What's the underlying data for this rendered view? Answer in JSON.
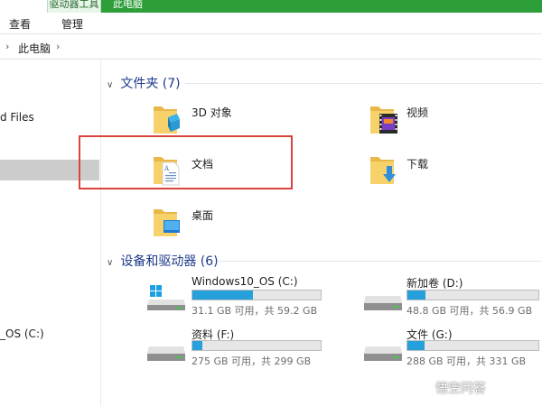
{
  "ribbon": {
    "context_tab": "驱动器工具",
    "window_title": "此电脑",
    "tabs": [
      "查看",
      "管理"
    ]
  },
  "address": {
    "path": "此电脑"
  },
  "nav": {
    "items": [
      "d Files",
      "_OS (C:)"
    ]
  },
  "sections": {
    "folders": {
      "title": "文件夹 (7)"
    },
    "drives": {
      "title": "设备和驱动器 (6)"
    }
  },
  "folders": [
    {
      "label": "3D 对象",
      "icon": "3d-objects-folder-icon"
    },
    {
      "label": "视频",
      "icon": "videos-folder-icon"
    },
    {
      "label": "文档",
      "icon": "documents-folder-icon"
    },
    {
      "label": "下载",
      "icon": "downloads-folder-icon"
    },
    {
      "label": "桌面",
      "icon": "desktop-folder-icon"
    }
  ],
  "drives": [
    {
      "name": "Windows10_OS (C:)",
      "free": "31.1 GB 可用，共 59.2 GB",
      "used_fraction": 0.47,
      "icon": "windows-drive-icon"
    },
    {
      "name": "新加卷 (D:)",
      "free": "48.8 GB 可用，共 56.9 GB",
      "used_fraction": 0.14,
      "icon": "hard-drive-icon"
    },
    {
      "name": "资料 (F:)",
      "free": "275 GB 可用，共 299 GB",
      "used_fraction": 0.08,
      "icon": "hard-drive-icon"
    },
    {
      "name": "文件 (G:)",
      "free": "288 GB 可用，共 331 GB",
      "used_fraction": 0.13,
      "icon": "hard-drive-icon"
    }
  ],
  "watermark": "悟空问答",
  "colors": {
    "ribbon_green": "#2e9e3a",
    "section_blue": "#1e3a8a",
    "usage_bar": "#26a0da",
    "highlight_box": "#d9443f"
  }
}
